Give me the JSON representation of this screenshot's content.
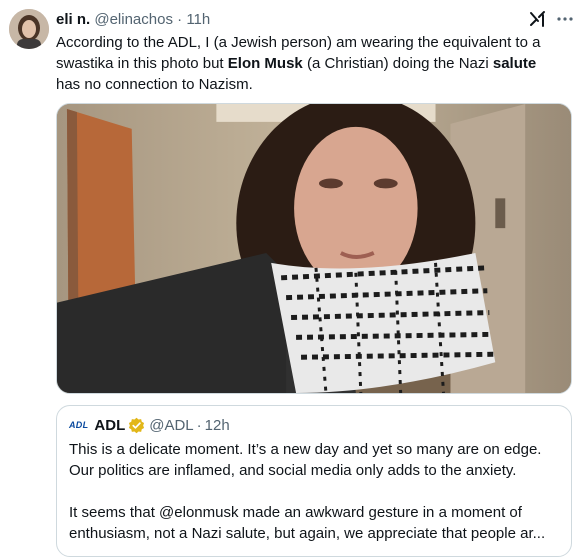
{
  "tweet": {
    "display_name": "eli n.",
    "handle": "@elinachos",
    "separator": "·",
    "time": "11h",
    "text_lines": [
      [
        "According to the ADL, I (a Jewish person) am wearing the equivalent to a"
      ],
      [
        "swastika in this photo but ",
        "Elon Musk",
        " (a Christian) doing the Nazi ",
        "salute"
      ],
      [
        "has no connection to Nazism."
      ]
    ],
    "grok_icon": "grok-icon",
    "more_icon": "more-icon"
  },
  "quote": {
    "logo_text": "ADL",
    "display_name": "ADL",
    "verified_color": "#e2b719",
    "handle": "@ADL",
    "separator": "·",
    "time": "12h",
    "line1": "This is a delicate moment. It’s a new day and yet so many are on edge.",
    "line2": "Our politics are inflamed, and social media only adds to the anxiety.",
    "line3": "It seems that @elonmusk made an awkward gesture in a moment of",
    "line4": "enthusiasm, not a Nazi salute, but again, we appreciate that people ar..."
  },
  "colors": {
    "text_primary": "#0f1419",
    "text_secondary": "#536471",
    "border": "#cfd9de"
  }
}
